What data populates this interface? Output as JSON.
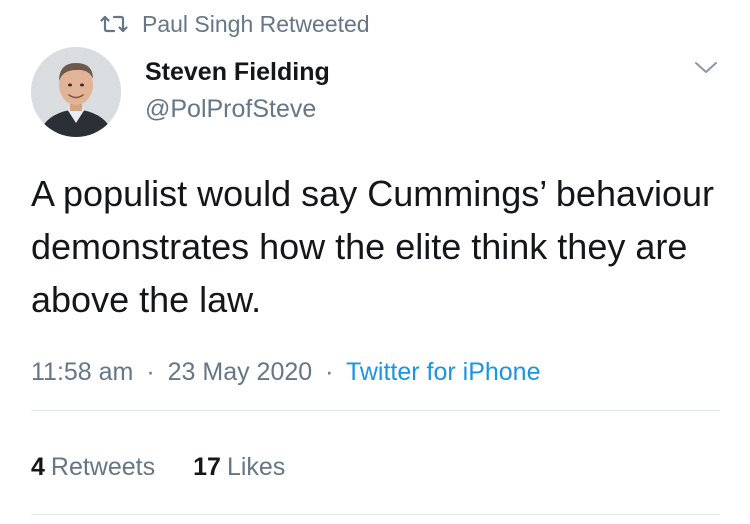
{
  "retweet": {
    "icon": "retweet-icon",
    "text": "Paul Singh Retweeted"
  },
  "author": {
    "display_name": "Steven Fielding",
    "handle": "@PolProfSteve",
    "avatar_icon": "avatar-photo"
  },
  "menu_icon": "chevron-down-icon",
  "tweet": {
    "text": "A populist would say Cummings’ behaviour demonstrates how the elite think they are above the law."
  },
  "meta": {
    "time": "11:58 am",
    "separator": "·",
    "date": "23 May 2020",
    "source": "Twitter for iPhone"
  },
  "stats": {
    "retweets_count": "4",
    "retweets_label": "Retweets",
    "likes_count": "17",
    "likes_label": "Likes"
  },
  "colors": {
    "text": "#14171a",
    "muted": "#657786",
    "link": "#1b95e0",
    "divider": "#e1e8ed"
  }
}
